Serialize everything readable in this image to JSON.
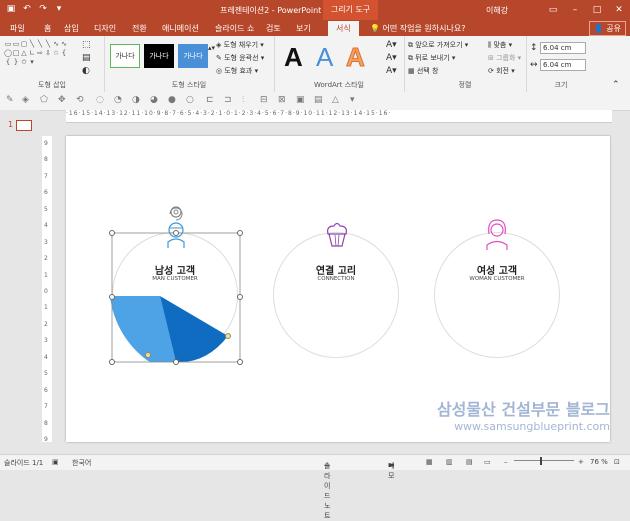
{
  "titlebar": {
    "doc_title": "프레젠테이션2 - PowerPoint",
    "context_tab": "그리기 도구",
    "user": "이해강"
  },
  "tabs": [
    "파일",
    "홈",
    "삽입",
    "디자인",
    "전환",
    "애니메이션",
    "슬라이드 쇼",
    "검토",
    "보기",
    "서식"
  ],
  "tell_me": "어떤 작업을 원하시나요?",
  "share_label": "공유",
  "ribbon": {
    "group_insert_shapes": "도형 삽입",
    "group_shape_styles": "도형 스타일",
    "group_wordart": "WordArt 스타일",
    "group_arrange": "정렬",
    "group_size": "크기",
    "style_samples": [
      "가나다",
      "가나다",
      "가나다"
    ],
    "shape_fill": "도형 채우기",
    "shape_outline": "도형 윤곽선",
    "shape_effects": "도형 효과",
    "wordart_sample": "A",
    "bring_forward": "앞으로 가져오기",
    "send_backward": "뒤로 보내기",
    "selection_pane": "선택 창",
    "align": "맞춤",
    "group": "그룹화",
    "rotate": "회전",
    "height": "6.04 cm",
    "width": "6.04 cm"
  },
  "thumb_number": "1",
  "ruler_h": "·16·15·14·13·12·11·10·9·8·7·6·5·4·3·2·1·0·1·2·3·4·5·6·7·8·9·10·11·12·13·14·15·16·",
  "ruler_v": [
    "9",
    "8",
    "7",
    "6",
    "5",
    "4",
    "3",
    "2",
    "1",
    "0",
    "1",
    "2",
    "3",
    "4",
    "5",
    "6",
    "7",
    "8",
    "9"
  ],
  "slide": {
    "items": [
      {
        "title": "남성 고객",
        "subtitle": "MAN CUSTOMER"
      },
      {
        "title": "연결 고리",
        "subtitle": "CONNECTION"
      },
      {
        "title": "여성 고객",
        "subtitle": "WOMAN CUSTOMER"
      }
    ]
  },
  "watermark": {
    "line1": "삼성물산 건설부문 블로그",
    "line2": "www.samsungblueprint.com"
  },
  "status": {
    "slide_info": "슬라이드 1/1",
    "language": "한국어",
    "notes": "슬라이드 노트",
    "comments": "메모",
    "zoom": "76 %"
  },
  "colors": {
    "accent": "#b7472a",
    "pie_light": "#4ea3e6",
    "pie_dark": "#0f6cc1",
    "icon_man": "#3a9ad9",
    "icon_cake": "#8e44ad",
    "icon_woman": "#e04fc1"
  }
}
